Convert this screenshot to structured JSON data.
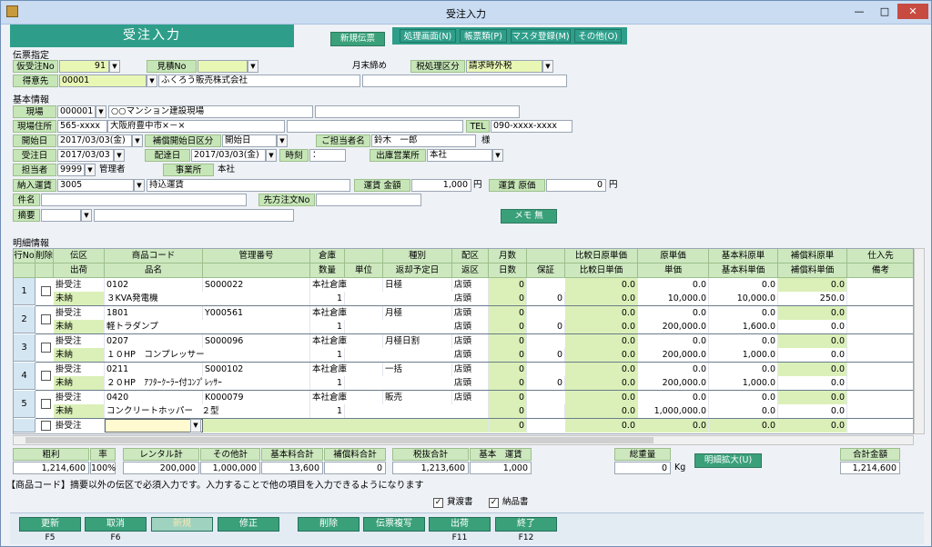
{
  "window": {
    "title": "受注入力",
    "minimize": "—",
    "maximize": "□",
    "close": "✕"
  },
  "panel_title": "受注入力",
  "toolbar": {
    "new_slip": "新規伝票",
    "menus": [
      "処理画面(N)",
      "帳票類(P)",
      "マスタ登録(M)",
      "その他(O)"
    ]
  },
  "slip": {
    "section": "伝票指定",
    "temp_label": "仮受注No",
    "temp_value": "91",
    "quote_label": "見積No",
    "quote_value": "",
    "month_end": "月末締め",
    "tax_label": "税処理区分",
    "tax_value": "請求時外税",
    "client_label": "得意先",
    "client_code": "00001",
    "client_name": "ふくろう販売株式会社"
  },
  "basic": {
    "section": "基本情報",
    "site_label": "現場",
    "site_code": "000001",
    "site_name": "○○マンション建設現場",
    "addr_label": "現場住所",
    "addr_zip": "565-xxxx",
    "addr_text": "大阪府豊中市×－×",
    "tel_label": "TEL",
    "tel_value": "090-xxxx-xxxx",
    "start_label": "開始日",
    "start_value": "2017/03/03(金)",
    "comp_label": "補償開始日区分",
    "comp_value": "開始日",
    "contact_label": "ご担当者名",
    "contact_value": "鈴木　一郎",
    "contact_suffix": "様",
    "order_label": "受注日",
    "order_value": "2017/03/03",
    "deliv_label": "配達日",
    "deliv_value": "2017/03/03(金)",
    "time_label": "時刻",
    "time_value": "：",
    "office_label": "出庫営業所",
    "office_value": "本社",
    "staff_label": "担当者",
    "staff_code": "9999",
    "staff_name": "管理者",
    "branch_label": "事業所",
    "branch_value": "本社",
    "ship_label": "納入運賃",
    "ship_code": "3005",
    "ship_name": "持込運賃",
    "fare_label": "運賃 金額",
    "fare_value": "1,000",
    "fare_unit": "円",
    "cost_label": "運賃 原価",
    "cost_value": "0",
    "cost_unit": "円",
    "subject_label": "件名",
    "subject_value": "",
    "ref_label": "先方注文No",
    "ref_value": "",
    "note_label": "摘要",
    "note_value": "",
    "memo_button": "メモ 無"
  },
  "detail": {
    "section": "明細情報",
    "header_top": [
      "行No",
      "削除",
      "伝区",
      "商品コード",
      "管理番号",
      "倉庫",
      "",
      "種別",
      "",
      "配区",
      "月数",
      "",
      "比較日原単価",
      "原単価",
      "基本料原単",
      "補償料原単",
      "仕入先"
    ],
    "header_bot": [
      "",
      "",
      "出荷",
      "品名",
      "",
      "数量",
      "単位",
      "返却予定日",
      "",
      "返区",
      "日数",
      "保証",
      "比較日単価",
      "単価",
      "基本料単価",
      "補償料単価",
      "備考"
    ],
    "rows": [
      {
        "no": "1",
        "kind": "掛受注",
        "ship": "未納",
        "code": "0102",
        "mgmt": "S000022",
        "name": "３KVA発電機",
        "wh": "本社倉庫",
        "qty": "1",
        "type": "日極",
        "dz1": "店頭",
        "dz2": "店頭",
        "m": "0",
        "d": "0",
        "g": "0",
        "cmp1": "0.0",
        "cmp2": "0.0",
        "cost": "0.0",
        "price": "10,000.0",
        "b1": "0.0",
        "b2": "10,000.0",
        "c1": "0.0",
        "c2": "250.0"
      },
      {
        "no": "2",
        "kind": "掛受注",
        "ship": "未納",
        "code": "1801",
        "mgmt": "Y000561",
        "name": "軽トラダンプ",
        "wh": "本社倉庫",
        "qty": "1",
        "type": "月極",
        "dz1": "店頭",
        "dz2": "店頭",
        "m": "0",
        "d": "0",
        "g": "0",
        "cmp1": "0.0",
        "cmp2": "0.0",
        "cost": "0.0",
        "price": "200,000.0",
        "b1": "0.0",
        "b2": "1,600.0",
        "c1": "0.0",
        "c2": "0.0"
      },
      {
        "no": "3",
        "kind": "掛受注",
        "ship": "未納",
        "code": "0207",
        "mgmt": "S000096",
        "name": "１０HP　コンプレッサー",
        "wh": "本社倉庫",
        "qty": "1",
        "type": "月極日割",
        "dz1": "店頭",
        "dz2": "店頭",
        "m": "0",
        "d": "0",
        "g": "0",
        "cmp1": "0.0",
        "cmp2": "0.0",
        "cost": "0.0",
        "price": "200,000.0",
        "b1": "0.0",
        "b2": "1,000.0",
        "c1": "0.0",
        "c2": "0.0"
      },
      {
        "no": "4",
        "kind": "掛受注",
        "ship": "未納",
        "code": "0211",
        "mgmt": "S000102",
        "name": "２０HP　ｱﾌﾀｰｸｰﾗｰ付ｺﾝﾌﾟﾚｯｻｰ",
        "wh": "本社倉庫",
        "qty": "1",
        "type": "一括",
        "dz1": "店頭",
        "dz2": "店頭",
        "m": "0",
        "d": "0",
        "g": "0",
        "cmp1": "0.0",
        "cmp2": "0.0",
        "cost": "0.0",
        "price": "200,000.0",
        "b1": "0.0",
        "b2": "1,000.0",
        "c1": "0.0",
        "c2": "0.0"
      },
      {
        "no": "5",
        "kind": "掛受注",
        "ship": "未納",
        "code": "0420",
        "mgmt": "K000079",
        "name": "コンクリートホッパー　２型",
        "wh": "本社倉庫",
        "qty": "1",
        "type": "販売",
        "dz1": "店頭",
        "dz2": "",
        "m": "0",
        "d": "0",
        "g": "",
        "cmp1": "0.0",
        "cmp2": "0.0",
        "cost": "0.0",
        "price": "1,000,000.0",
        "b1": "0.0",
        "b2": "0.0",
        "c1": "0.0",
        "c2": "0.0"
      }
    ],
    "new_row": {
      "kind": "掛受注",
      "m": "0",
      "cmp": "0.0",
      "cost": "0.0",
      "b": "0.0",
      "c": "0.0"
    }
  },
  "summary": {
    "gross_label": "粗利",
    "gross_value": "1,214,600",
    "rate_label": "率",
    "rate_value": "100%",
    "rental_label": "レンタル計",
    "rental_value": "200,000",
    "other_label": "その他計",
    "other_value": "1,000,000",
    "basic_label": "基本料合計",
    "basic_value": "13,600",
    "comp_label": "補償料合計",
    "comp_value": "0",
    "tax_label": "税抜合計",
    "tax_value": "1,213,600",
    "fare_label": "基本　運賃",
    "fare_value": "1,000",
    "weight_label": "総重量",
    "weight_value": "0",
    "weight_unit": "Kg",
    "expand_button": "明細拡大(U)",
    "total_label": "合計金額",
    "total_value": "1,214,600"
  },
  "hint": "【商品コード】摘要以外の伝区で必須入力です。入力することで他の項目を入力できるようになります",
  "checks": {
    "loan": "貸渡書",
    "delivery": "納品書"
  },
  "footer": {
    "buttons": [
      "更新",
      "取消",
      "新規",
      "修正",
      "削除",
      "伝票複写",
      "出荷",
      "終了"
    ],
    "keys": [
      "F5",
      "F6",
      "",
      "",
      "",
      "",
      "F11",
      "F12"
    ]
  },
  "colors": {
    "accent": "#2e9e8a",
    "header_green": "#cde8bf",
    "input_yellow": "#e9f7b5"
  }
}
